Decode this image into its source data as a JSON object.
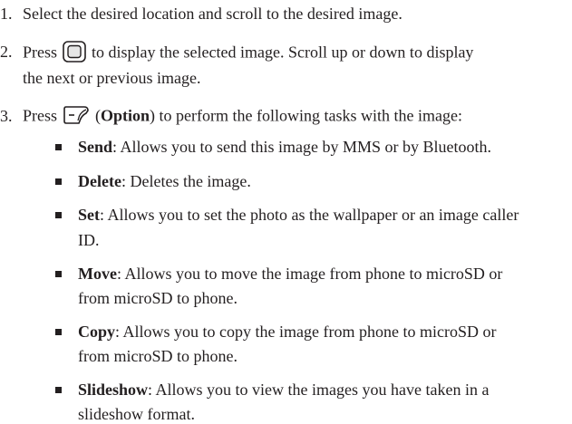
{
  "steps": [
    {
      "num": "1.",
      "text": "Select the desired location and scroll to the desired image."
    },
    {
      "num": "2.",
      "pre": "Press",
      "post": "to display the selected image. Scroll up or down to display",
      "cont": "the next or previous image."
    },
    {
      "num": "3.",
      "pre": "Press",
      "mid_open": "(",
      "mid_bold": "Option",
      "mid_close": ")",
      "post": "to perform the following tasks with the image:"
    }
  ],
  "icons": {
    "center_key": "center-select-key-icon",
    "option_key": "left-soft-key-icon"
  },
  "bullets": [
    {
      "term": "Send",
      "desc": ": Allows you to send this image by MMS or by Bluetooth."
    },
    {
      "term": "Delete",
      "desc": ": Deletes the image."
    },
    {
      "term": "Set",
      "desc": ": Allows you to set the photo as the wallpaper or an image caller",
      "cont": "ID."
    },
    {
      "term": "Move",
      "desc": ": Allows you to move the image from phone to microSD or",
      "cont": "from microSD to phone."
    },
    {
      "term": "Copy",
      "desc": ": Allows you to copy the image from phone to microSD or",
      "cont": "from microSD to phone."
    },
    {
      "term": "Slideshow",
      "desc": ": Allows you to view the images you have taken in a",
      "cont": "slideshow format."
    }
  ]
}
